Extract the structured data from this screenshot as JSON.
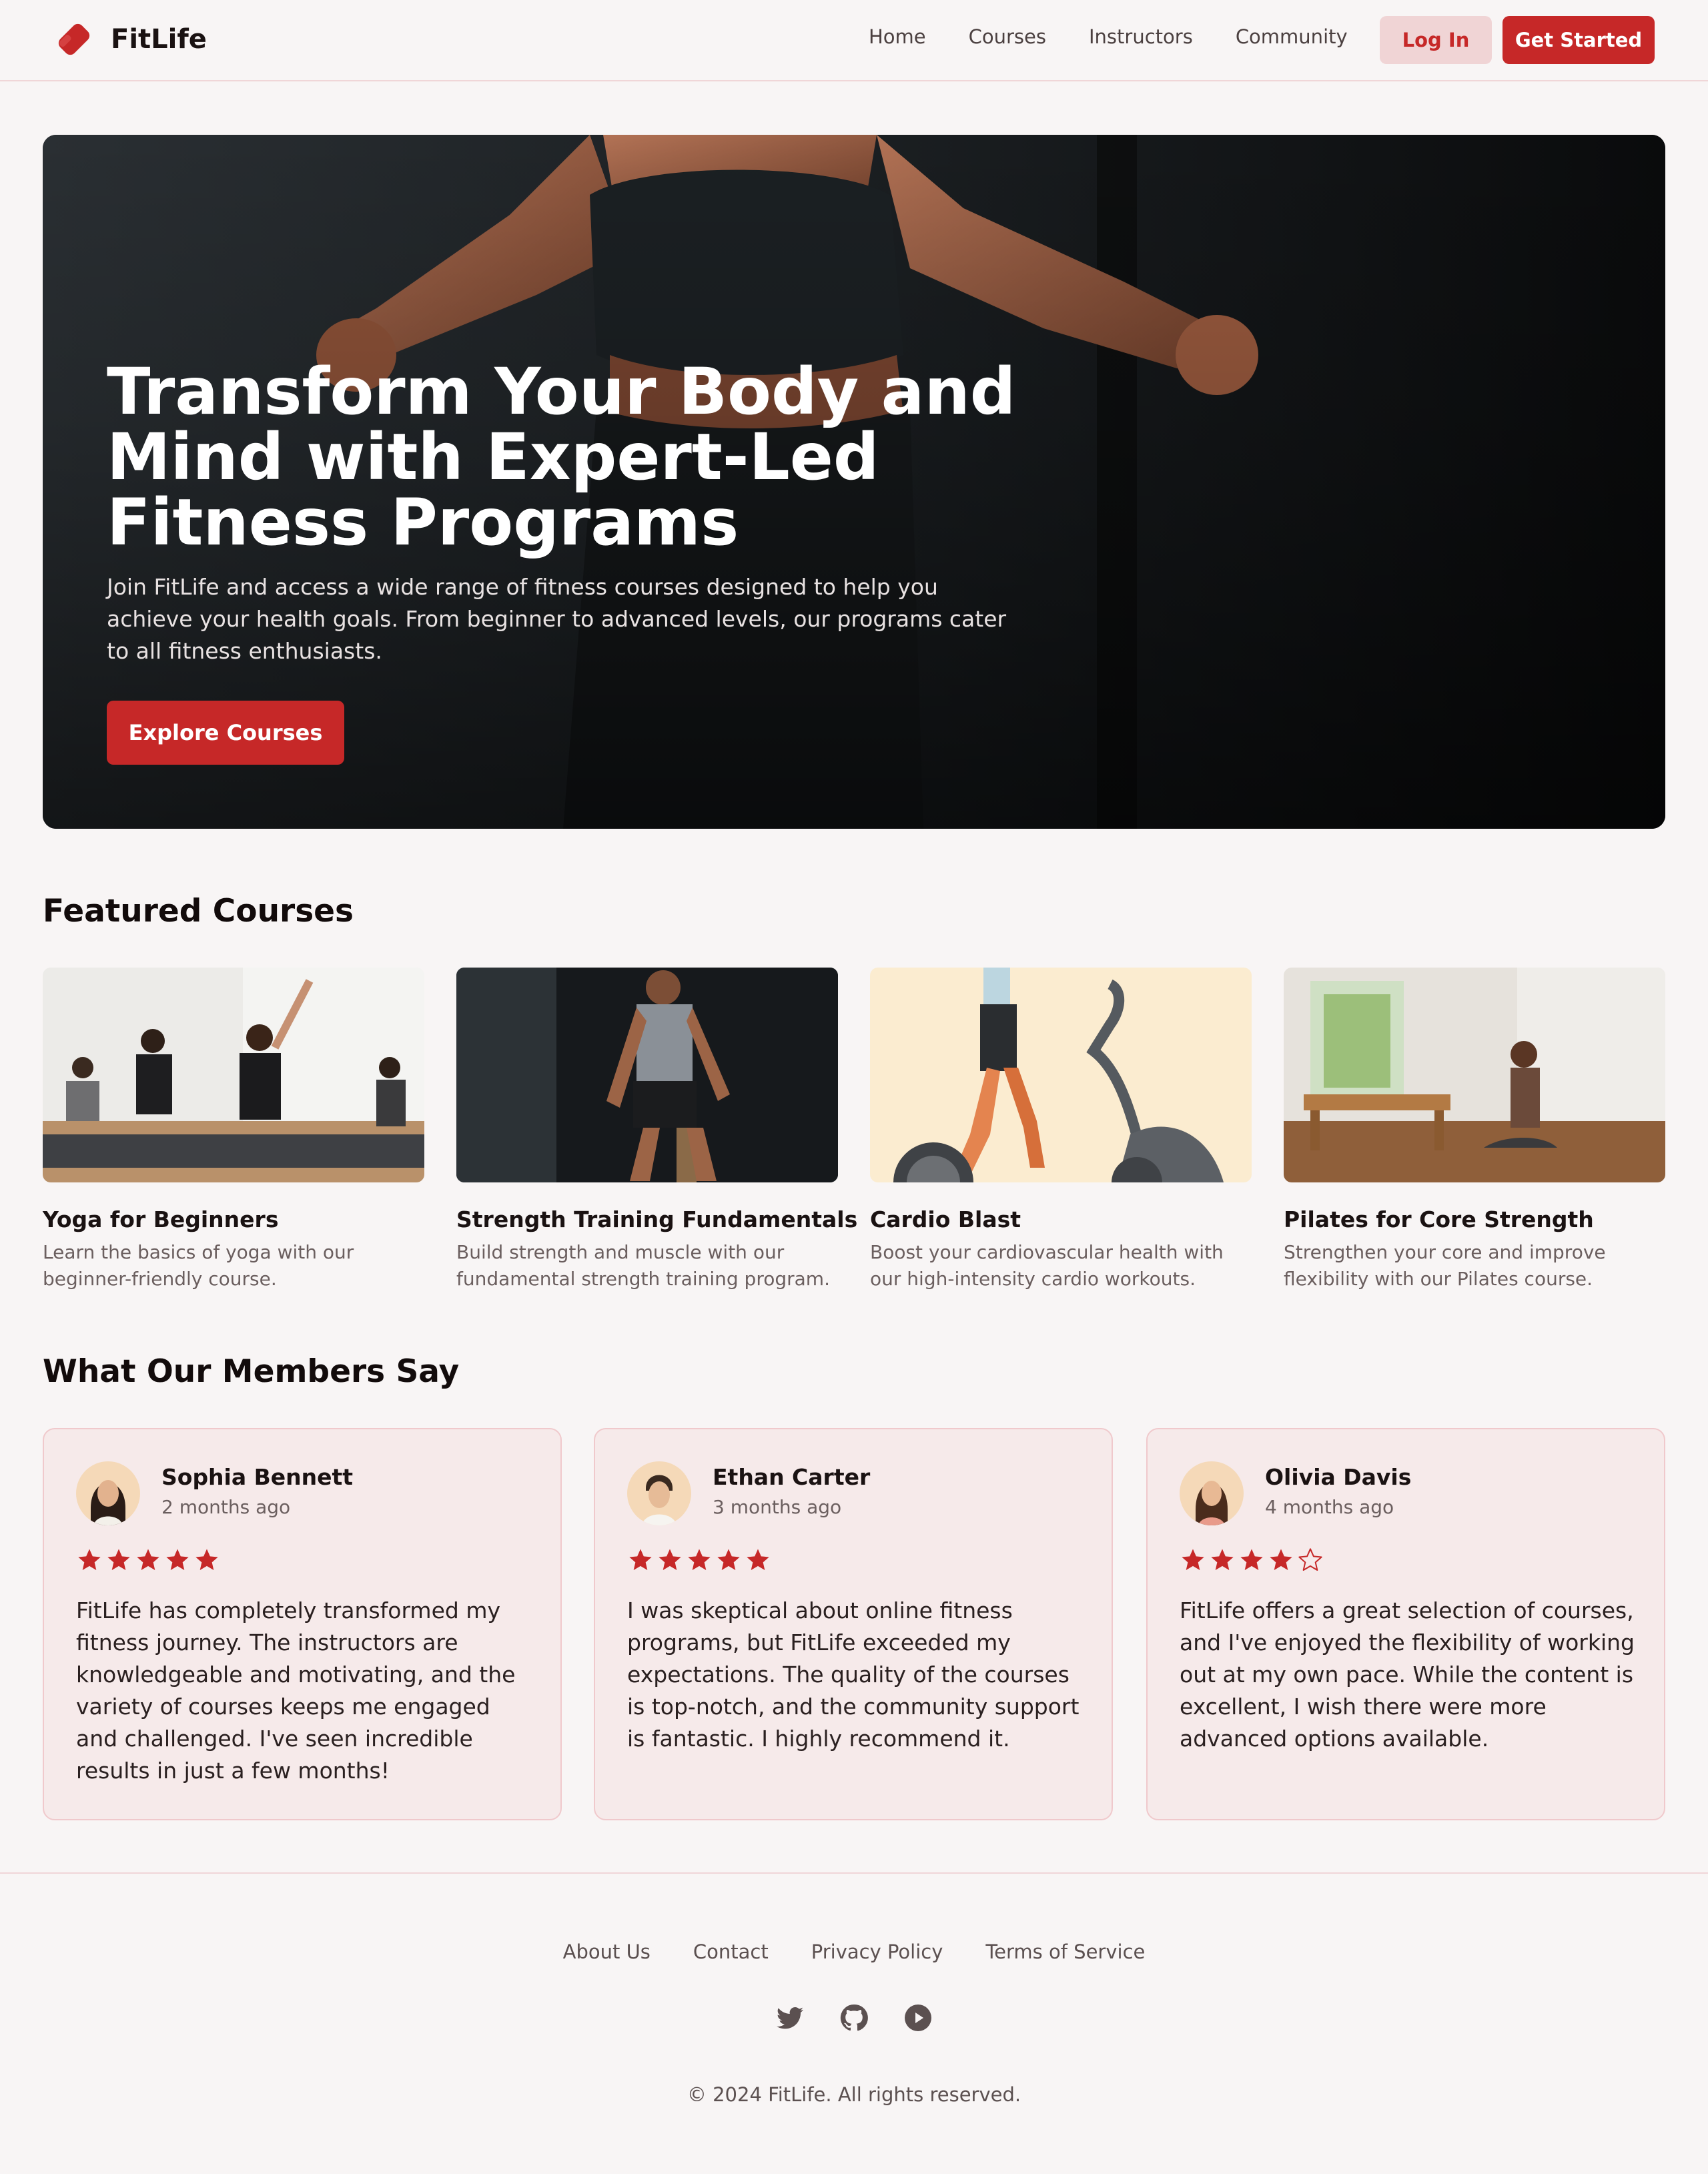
{
  "brand": {
    "name": "FitLife",
    "accent": "#c62828",
    "logo_icon": "tag-icon"
  },
  "nav": {
    "items": [
      "Home",
      "Courses",
      "Instructors",
      "Community"
    ]
  },
  "auth": {
    "login_label": "Log In",
    "signup_label": "Get Started"
  },
  "hero": {
    "title": "Transform Your Body and Mind with Expert-Led Fitness Programs",
    "subtitle": "Join FitLife and access a wide range of fitness courses designed to help you achieve your health goals. From beginner to advanced levels, our programs cater to all fitness enthusiasts.",
    "cta_label": "Explore Courses"
  },
  "featured": {
    "heading": "Featured Courses",
    "courses": [
      {
        "title": "Yoga for Beginners",
        "description": "Learn the basics of yoga with our beginner-friendly course."
      },
      {
        "title": "Strength Training Fundamentals",
        "description": "Build strength and muscle with our fundamental strength training program."
      },
      {
        "title": "Cardio Blast",
        "description": "Boost your cardiovascular health with our high-intensity cardio workouts."
      },
      {
        "title": "Pilates for Core Strength",
        "description": "Strengthen your core and improve flexibility with our Pilates course."
      }
    ]
  },
  "testimonials": {
    "heading": "What Our Members Say",
    "reviews": [
      {
        "name": "Sophia Bennett",
        "time": "2 months ago",
        "rating": 5,
        "text": "FitLife has completely transformed my fitness journey. The instructors are knowledgeable and motivating, and the variety of courses keeps me engaged and challenged. I've seen incredible results in just a few months!"
      },
      {
        "name": "Ethan Carter",
        "time": "3 months ago",
        "rating": 5,
        "text": "I was skeptical about online fitness programs, but FitLife exceeded my expectations. The quality of the courses is top-notch, and the community support is fantastic. I highly recommend it."
      },
      {
        "name": "Olivia Davis",
        "time": "4 months ago",
        "rating": 4,
        "text": "FitLife offers a great selection of courses, and I've enjoyed the flexibility of working out at my own pace. While the content is excellent, I wish there were more advanced options available."
      }
    ]
  },
  "footer": {
    "links": [
      "About Us",
      "Contact",
      "Privacy Policy",
      "Terms of Service"
    ],
    "social_icons": [
      "twitter-icon",
      "github-icon",
      "youtube-play-icon"
    ],
    "copyright": "© 2024 FitLife. All rights reserved."
  }
}
